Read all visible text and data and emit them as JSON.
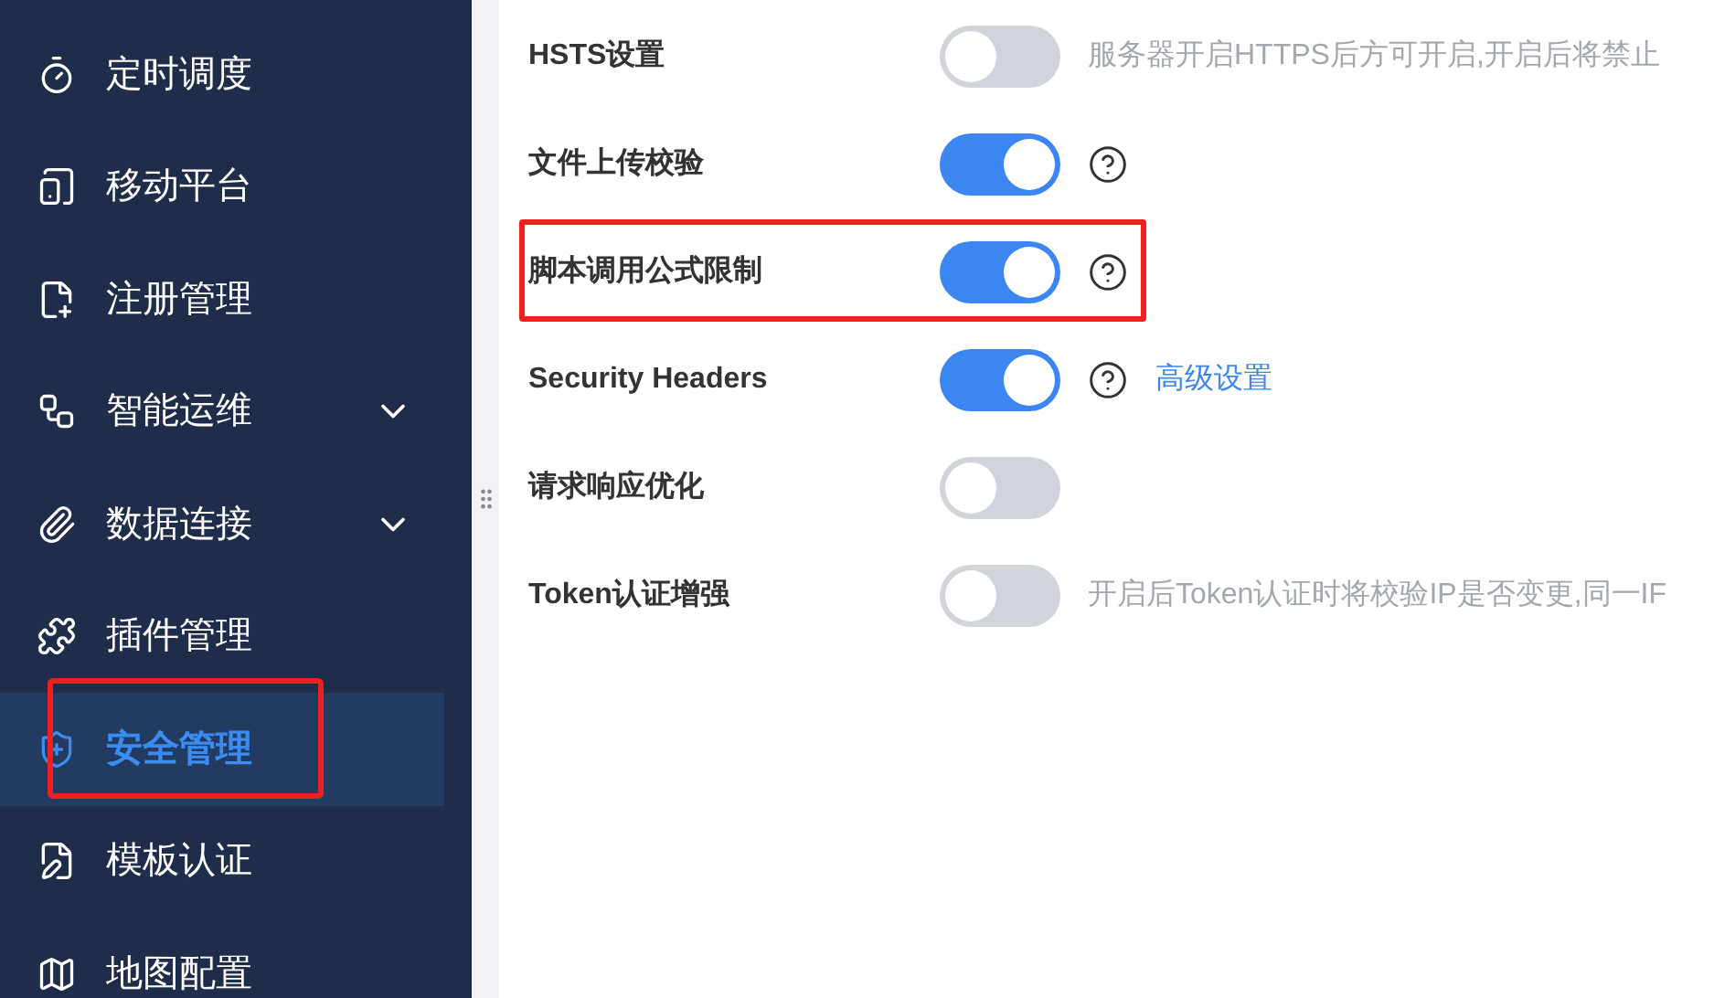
{
  "sidebar": {
    "items": [
      {
        "label": "定时调度",
        "kind": "link",
        "selected": false,
        "highlighted": false
      },
      {
        "label": "移动平台",
        "kind": "link",
        "selected": false,
        "highlighted": false
      },
      {
        "label": "注册管理",
        "kind": "link",
        "selected": false,
        "highlighted": false
      },
      {
        "label": "智能运维",
        "kind": "group",
        "selected": false,
        "highlighted": false
      },
      {
        "label": "数据连接",
        "kind": "group",
        "selected": false,
        "highlighted": false
      },
      {
        "label": "插件管理",
        "kind": "link",
        "selected": false,
        "highlighted": false
      },
      {
        "label": "安全管理",
        "kind": "link",
        "selected": true,
        "highlighted": true
      },
      {
        "label": "模板认证",
        "kind": "link",
        "selected": false,
        "highlighted": false
      },
      {
        "label": "地图配置",
        "kind": "link",
        "selected": false,
        "highlighted": false
      }
    ]
  },
  "settings": [
    {
      "label": "HSTS设置",
      "on": false,
      "help": false,
      "highlighted": false,
      "description": "服务器开启HTTPS后方可开启,开启后将禁止"
    },
    {
      "label": "文件上传校验",
      "on": true,
      "help": true,
      "highlighted": false
    },
    {
      "label": "脚本调用公式限制",
      "on": true,
      "help": true,
      "highlighted": true
    },
    {
      "label": "Security Headers",
      "on": true,
      "help": true,
      "highlighted": false,
      "link": "高级设置"
    },
    {
      "label": "请求响应优化",
      "on": false,
      "help": false,
      "highlighted": false
    },
    {
      "label": "Token认证增强",
      "on": false,
      "help": false,
      "highlighted": false,
      "description": "开启后Token认证时将校验IP是否变更,同一IF"
    }
  ]
}
